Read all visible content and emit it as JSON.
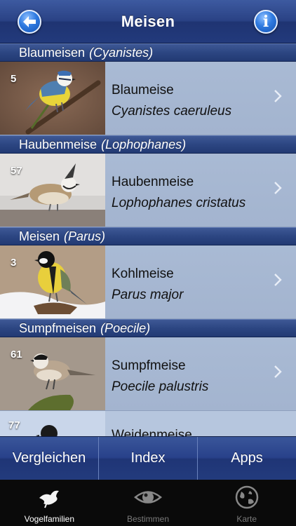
{
  "navbar": {
    "title": "Meisen",
    "back_icon": "back-arrow-icon",
    "info_icon": "info-icon",
    "info_glyph": "i"
  },
  "sections": [
    {
      "name": "Blaumeisen",
      "genus": "(Cyanistes)",
      "row": {
        "count": "5",
        "common": "Blaumeise",
        "latin": "Cyanistes caeruleus"
      }
    },
    {
      "name": "Haubenmeise",
      "genus": "(Lophophanes)",
      "row": {
        "count": "57",
        "common": "Haubenmeise",
        "latin": "Lophophanes cristatus"
      }
    },
    {
      "name": "Meisen",
      "genus": "(Parus)",
      "row": {
        "count": "3",
        "common": "Kohlmeise",
        "latin": "Parus major"
      }
    },
    {
      "name": "Sumpfmeisen",
      "genus": "(Poecile)",
      "row": {
        "count": "61",
        "common": "Sumpfmeise",
        "latin": "Poecile palustris"
      }
    }
  ],
  "partial_row": {
    "count": "77",
    "common": "Weidenmeise"
  },
  "bottom_bar": {
    "compare": "Vergleichen",
    "index": "Index",
    "apps": "Apps"
  },
  "tabs": [
    {
      "label": "Vogelfamilien",
      "icon": "bird-icon",
      "active": true
    },
    {
      "label": "Bestimmen",
      "icon": "eye-icon",
      "active": false
    },
    {
      "label": "Karte",
      "icon": "globe-icon",
      "active": false
    }
  ],
  "colors": {
    "navbar": "#2a4285",
    "row": "#a9bad4",
    "section": "#2c4682",
    "tabbar": "#0a0a0a"
  }
}
